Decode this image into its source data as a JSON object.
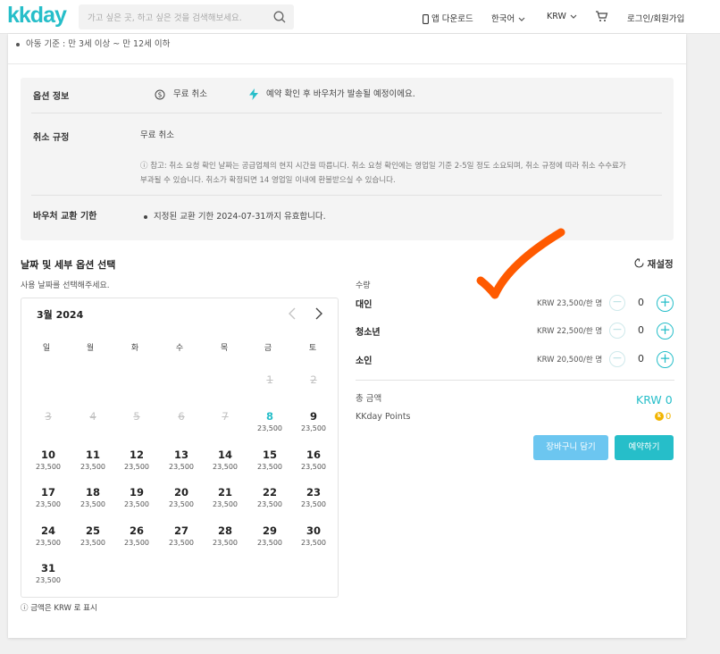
{
  "header": {
    "logo": "kkday",
    "search_placeholder": "가고 싶은 곳, 하고 싶은 것을 검색해보세요.",
    "app_download": "앱 다운로드",
    "language": "한국어",
    "currency": "KRW",
    "login": "로그인/회원가입"
  },
  "top_bullet": "아동 기준 : 만 3세 이상 ~ 만 12세 이하",
  "info": {
    "option_label": "옵션 정보",
    "option_value": "무료 취소",
    "option_notice": "예약 확인 후 바우처가 발송될 예정이에요.",
    "cancel_label": "취소 규정",
    "cancel_value": "무료 취소",
    "cancel_note_1": "ⓘ 참고: 취소 요청 확인 날짜는 공급업체의 현지 시간을 따릅니다. 취소 요청 확인에는 영업일 기준 2-5일 정도 소요되며, 취소 규정에 따라 취소 수수료가",
    "cancel_note_2": "부과될 수 있습니다. 취소가 확정되면 14 영업일 이내에 환불받으실 수 있습니다.",
    "voucher_label": "바우처 교환 기한",
    "voucher_value": "지정된 교환 기한 2024-07-31까지 유효합니다."
  },
  "section": {
    "title": "날짜 및 세부 옵션 선택",
    "reset": "재설정",
    "subtitle": "사용 날짜를 선택해주세요."
  },
  "calendar": {
    "month": "3월 2024",
    "weekdays": [
      "일",
      "월",
      "화",
      "수",
      "목",
      "금",
      "토"
    ],
    "days": [
      {
        "d": "1",
        "p": "",
        "disabled": true
      },
      {
        "d": "2",
        "p": "",
        "disabled": true
      },
      {
        "d": "3",
        "p": "",
        "disabled": true
      },
      {
        "d": "4",
        "p": "",
        "disabled": true
      },
      {
        "d": "5",
        "p": "",
        "disabled": true
      },
      {
        "d": "6",
        "p": "",
        "disabled": true
      },
      {
        "d": "7",
        "p": "",
        "disabled": true
      },
      {
        "d": "8",
        "p": "23,500",
        "today": true
      },
      {
        "d": "9",
        "p": "23,500"
      },
      {
        "d": "10",
        "p": "23,500"
      },
      {
        "d": "11",
        "p": "23,500"
      },
      {
        "d": "12",
        "p": "23,500"
      },
      {
        "d": "13",
        "p": "23,500"
      },
      {
        "d": "14",
        "p": "23,500"
      },
      {
        "d": "15",
        "p": "23,500"
      },
      {
        "d": "16",
        "p": "23,500"
      },
      {
        "d": "17",
        "p": "23,500"
      },
      {
        "d": "18",
        "p": "23,500"
      },
      {
        "d": "19",
        "p": "23,500"
      },
      {
        "d": "20",
        "p": "23,500"
      },
      {
        "d": "21",
        "p": "23,500"
      },
      {
        "d": "22",
        "p": "23,500"
      },
      {
        "d": "23",
        "p": "23,500"
      },
      {
        "d": "24",
        "p": "23,500"
      },
      {
        "d": "25",
        "p": "23,500"
      },
      {
        "d": "26",
        "p": "23,500"
      },
      {
        "d": "27",
        "p": "23,500"
      },
      {
        "d": "28",
        "p": "23,500"
      },
      {
        "d": "29",
        "p": "23,500"
      },
      {
        "d": "30",
        "p": "23,500"
      },
      {
        "d": "31",
        "p": "23,500"
      }
    ],
    "footnote": "ⓘ 금액은 KRW 로 표시"
  },
  "quantity": {
    "label": "수량",
    "rows": [
      {
        "name": "대인",
        "price": "KRW 23,500/한 명",
        "count": "0"
      },
      {
        "name": "청소년",
        "price": "KRW 22,500/한 명",
        "count": "0"
      },
      {
        "name": "소인",
        "price": "KRW 20,500/한 명",
        "count": "0"
      }
    ],
    "total_label": "총 금액",
    "total_value": "KRW 0",
    "points_label": "KKday Points",
    "points_value": "0",
    "cart_button": "장바구니 담기",
    "book_button": "예약하기"
  },
  "colors": {
    "accent": "#26bec9",
    "cart": "#6cc6f0",
    "check": "#ff5a00",
    "points": "#f2b400"
  }
}
